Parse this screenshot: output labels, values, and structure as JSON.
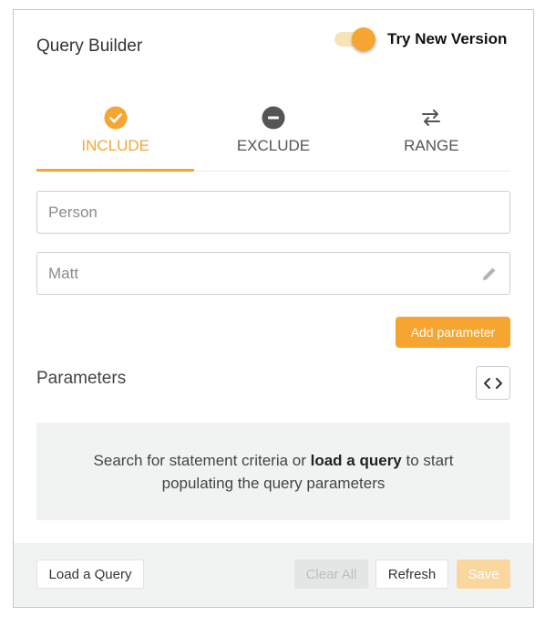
{
  "header": {
    "title": "Query Builder",
    "toggle_label": "Try New Version",
    "toggle_on": true
  },
  "tabs": [
    {
      "label": "INCLUDE",
      "icon": "check-circle-icon",
      "active": true
    },
    {
      "label": "EXCLUDE",
      "icon": "minus-circle-icon",
      "active": false
    },
    {
      "label": "RANGE",
      "icon": "swap-arrows-icon",
      "active": false
    }
  ],
  "fields": {
    "person": {
      "placeholder": "Person",
      "value": ""
    },
    "name": {
      "placeholder": "Matt",
      "value": ""
    }
  },
  "add_parameter_label": "Add parameter",
  "parameters": {
    "title": "Parameters",
    "empty_text_before": "Search for statement criteria or ",
    "empty_text_bold": "load a query",
    "empty_text_after": " to start populating the query parameters"
  },
  "footer": {
    "load_label": "Load a Query",
    "clear_label": "Clear All",
    "refresh_label": "Refresh",
    "save_label": "Save"
  },
  "colors": {
    "accent": "#f6a531",
    "accent_light": "#f9d79f",
    "panel_bg": "#f1f3f3"
  }
}
